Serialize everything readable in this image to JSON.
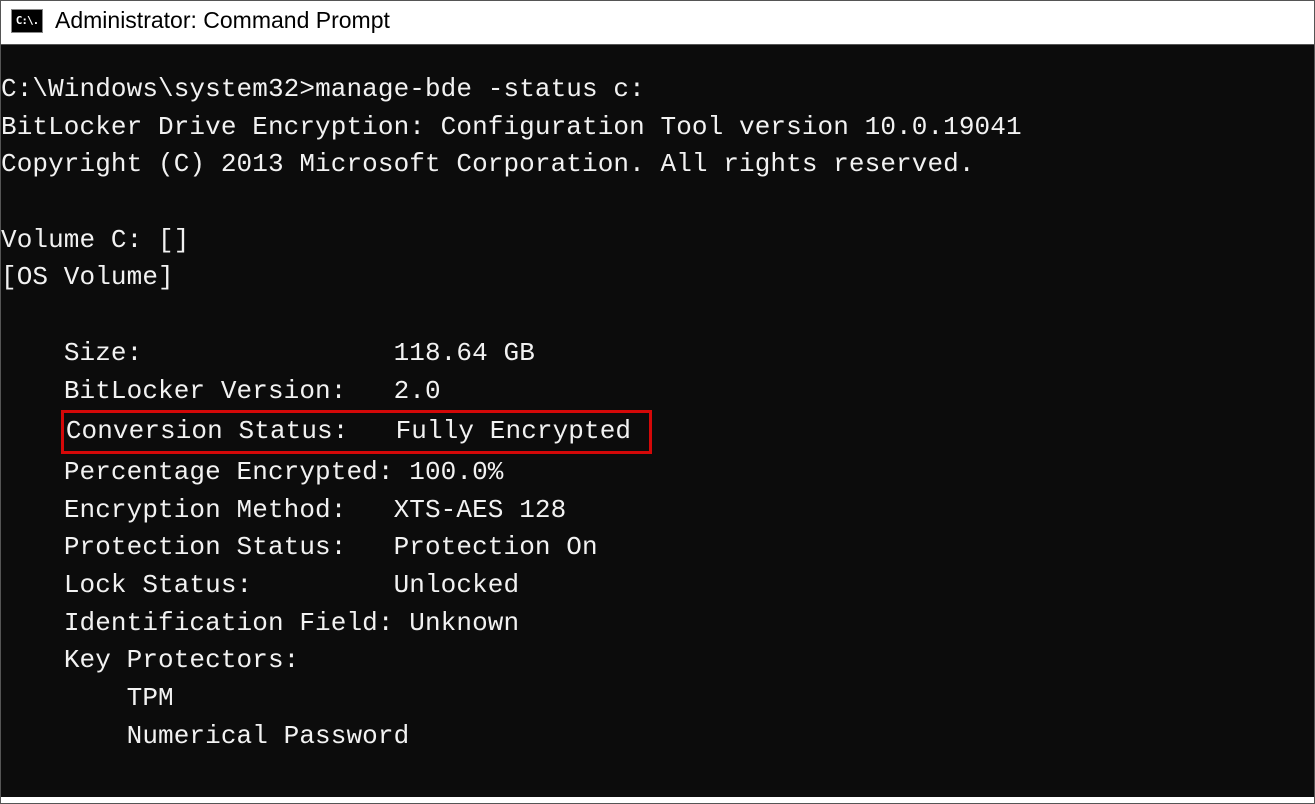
{
  "window": {
    "icon_text": "C:\\.",
    "title": "Administrator: Command Prompt"
  },
  "terminal": {
    "prompt": "C:\\Windows\\system32>",
    "command": "manage-bde -status c:",
    "header_line1": "BitLocker Drive Encryption: Configuration Tool version 10.0.19041",
    "header_line2": "Copyright (C) 2013 Microsoft Corporation. All rights reserved.",
    "volume_line": "Volume C: []",
    "volume_desc": "[OS Volume]",
    "fields": {
      "size": {
        "label": "Size:",
        "pad": "                ",
        "value": "118.64 GB"
      },
      "bitlocker_version": {
        "label": "BitLocker Version:",
        "pad": "   ",
        "value": "2.0"
      },
      "conversion_status": {
        "label": "Conversion Status:",
        "pad": "   ",
        "value": "Fully Encrypted"
      },
      "percentage_encrypted": {
        "label": "Percentage Encrypted:",
        "pad": " ",
        "value": "100.0%"
      },
      "encryption_method": {
        "label": "Encryption Method:",
        "pad": "   ",
        "value": "XTS-AES 128"
      },
      "protection_status": {
        "label": "Protection Status:",
        "pad": "   ",
        "value": "Protection On"
      },
      "lock_status": {
        "label": "Lock Status:",
        "pad": "         ",
        "value": "Unlocked"
      },
      "identification_field": {
        "label": "Identification Field:",
        "pad": " ",
        "value": "Unknown"
      },
      "key_protectors": {
        "label": "Key Protectors:",
        "pad": "",
        "value": ""
      }
    },
    "protectors": {
      "item1": "TPM",
      "item2": "Numerical Password"
    },
    "indent1": "    ",
    "indent2": "        "
  }
}
